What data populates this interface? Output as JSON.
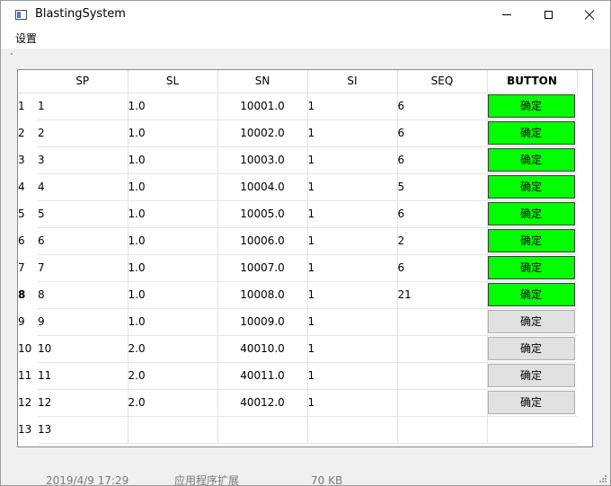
{
  "window": {
    "title": "BlastingSystem"
  },
  "menubar": {
    "items": [
      "设置"
    ]
  },
  "table": {
    "columns": [
      "SP",
      "SL",
      "SN",
      "SI",
      "SEQ",
      "BUTTON"
    ],
    "current_row": 8,
    "rows": [
      {
        "num": "1",
        "sp": "1",
        "sl": "1.0",
        "sn": "10001.0",
        "si": "1",
        "seq": "6",
        "button": "确定",
        "active": true
      },
      {
        "num": "2",
        "sp": "2",
        "sl": "1.0",
        "sn": "10002.0",
        "si": "1",
        "seq": "6",
        "button": "确定",
        "active": true
      },
      {
        "num": "3",
        "sp": "3",
        "sl": "1.0",
        "sn": "10003.0",
        "si": "1",
        "seq": "6",
        "button": "确定",
        "active": true
      },
      {
        "num": "4",
        "sp": "4",
        "sl": "1.0",
        "sn": "10004.0",
        "si": "1",
        "seq": "5",
        "button": "确定",
        "active": true
      },
      {
        "num": "5",
        "sp": "5",
        "sl": "1.0",
        "sn": "10005.0",
        "si": "1",
        "seq": "6",
        "button": "确定",
        "active": true
      },
      {
        "num": "6",
        "sp": "6",
        "sl": "1.0",
        "sn": "10006.0",
        "si": "1",
        "seq": "2",
        "button": "确定",
        "active": true
      },
      {
        "num": "7",
        "sp": "7",
        "sl": "1.0",
        "sn": "10007.0",
        "si": "1",
        "seq": "6",
        "button": "确定",
        "active": true
      },
      {
        "num": "8",
        "sp": "8",
        "sl": "1.0",
        "sn": "10008.0",
        "si": "1",
        "seq": "21",
        "button": "确定",
        "active": true
      },
      {
        "num": "9",
        "sp": "9",
        "sl": "1.0",
        "sn": "10009.0",
        "si": "1",
        "seq": "",
        "button": "确定",
        "active": false
      },
      {
        "num": "10",
        "sp": "10",
        "sl": "2.0",
        "sn": "40010.0",
        "si": "1",
        "seq": "",
        "button": "确定",
        "active": false
      },
      {
        "num": "11",
        "sp": "11",
        "sl": "2.0",
        "sn": "40011.0",
        "si": "1",
        "seq": "",
        "button": "确定",
        "active": false
      },
      {
        "num": "12",
        "sp": "12",
        "sl": "2.0",
        "sn": "40012.0",
        "si": "1",
        "seq": "",
        "button": "确定",
        "active": false
      },
      {
        "num": "13",
        "sp": "13",
        "sl": "",
        "sn": "",
        "si": "",
        "seq": "",
        "button": "",
        "active": null
      }
    ]
  },
  "background_window": {
    "date": "2019/4/9 17:29",
    "type": "应用程序扩展",
    "size": "70 KB"
  },
  "colors": {
    "button_active": "#00ff00",
    "button_inactive": "#e1e1e1",
    "grid_line": "#e4e4e4",
    "frame_border": "#828790"
  }
}
